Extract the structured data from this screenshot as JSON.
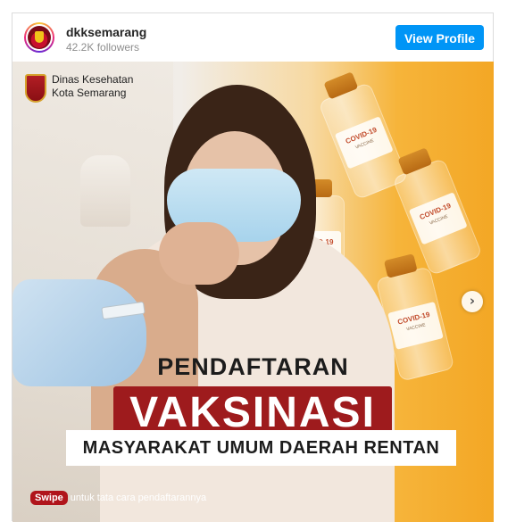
{
  "profile": {
    "username": "dkksemarang",
    "followers": "42.2K followers",
    "view_profile_label": "View Profile"
  },
  "post": {
    "org_line1": "Dinas Kesehatan",
    "org_line2": "Kota Semarang",
    "title_line1": "PENDAFTARAN",
    "title_line2": "VAKSINASI",
    "title_line3": "MASYARAKAT UMUM DAERAH RENTAN",
    "swipe_label": "Swipe",
    "swipe_text": "untuk tata cara pendaftarannya",
    "vial_label": "COVID-19",
    "vial_sublabel": "VACCINE"
  },
  "icons": {
    "next": "chevron-right-icon",
    "avatar": "avatar",
    "org_logo": "city-emblem-icon"
  },
  "colors": {
    "accent_blue": "#0095f6",
    "title_red": "#9e1b1d",
    "swipe_red": "#b0141b",
    "bg_orange": "#f3a725"
  }
}
